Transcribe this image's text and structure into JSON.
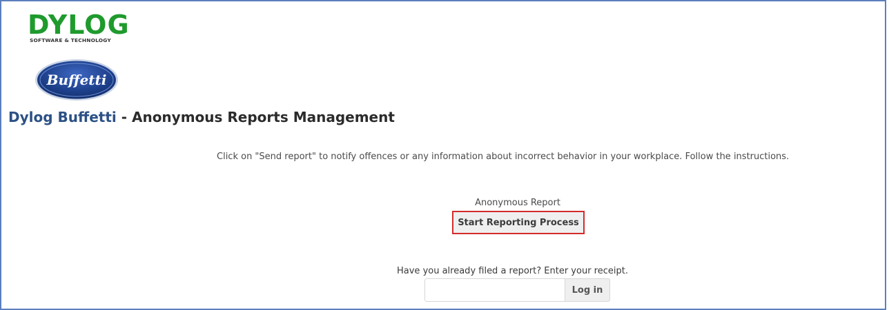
{
  "brand": {
    "dylog_logo_text": "DYLOG",
    "dylog_tagline": "SOFTWARE & TECHNOLOGY",
    "buffetti_logo_text": "Buffetti",
    "colors": {
      "dylog_green": "#1f9a2d",
      "buffetti_blue": "#1d3f8a",
      "title_brand": "#2c5185",
      "highlight_red": "#d42a2a"
    }
  },
  "header": {
    "brand_name": "Dylog Buffetti",
    "title_suffix": " - Anonymous Reports Management"
  },
  "intro": {
    "text": "Click on \"Send report\" to notify offences or any information about incorrect behavior in your workplace. Follow the instructions."
  },
  "report": {
    "label": "Anonymous Report",
    "start_button": "Start Reporting Process"
  },
  "receipt": {
    "prompt": "Have you already filed a report? Enter your receipt.",
    "input_value": "",
    "login_button": "Log in"
  }
}
